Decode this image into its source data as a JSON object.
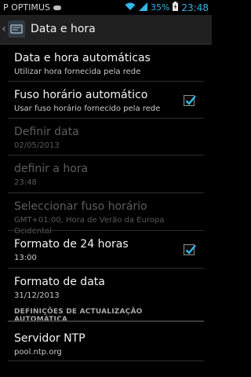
{
  "status_bar": {
    "carrier": "P OPTIMUS",
    "battery_percent": "35%",
    "time": "23:48"
  },
  "action_bar": {
    "title": "Data e hora"
  },
  "items": [
    {
      "title": "Data e hora automáticas",
      "summary": "Utilizar hora fornecida pela rede"
    },
    {
      "title": "Fuso horário automático",
      "summary": "Usar fuso horário fornecido pela rede",
      "checked": true
    },
    {
      "title": "Definir data",
      "summary": "02/05/2013",
      "disabled": true
    },
    {
      "title": "definir a hora",
      "summary": "23:48",
      "disabled": true
    },
    {
      "title": "Seleccionar fuso horário",
      "summary": "GMT+01:00, Hora de Verão da Europa Ocidental",
      "disabled": true
    },
    {
      "title": "Formato de 24 horas",
      "summary": "13:00",
      "checked": true
    },
    {
      "title": "Formato de data",
      "summary": "31/12/2013"
    }
  ],
  "section": {
    "header": "DEFINIÇÕES DE ACTUALIZAÇÃO AUTOMÁTICA"
  },
  "ntp": {
    "title": "Servidor NTP",
    "summary": "pool.ntp.org"
  },
  "colors": {
    "accent": "#33b5e5",
    "background": "#000000",
    "disabled_text": "#5e5e5e"
  }
}
